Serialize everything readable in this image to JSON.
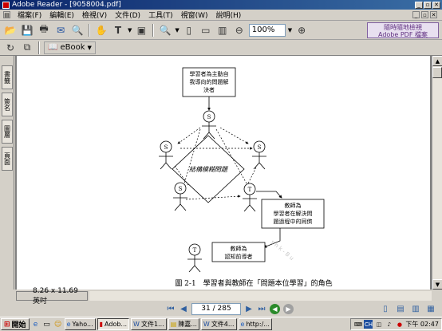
{
  "window": {
    "title": "Adobe Reader - [9058004.pdf]"
  },
  "menu": [
    "檔案(F)",
    "編輯(E)",
    "檢視(V)",
    "文件(D)",
    "工具(T)",
    "視窗(W)",
    "說明(H)"
  ],
  "toolbar": {
    "zoom_value": "100%",
    "ebook_label": "eBook"
  },
  "ad_box": {
    "line1": "隨時隨地檢視",
    "line2": "Adobe PDF 檔案"
  },
  "nav_tabs": [
    "書籤",
    "簽名",
    "圖層",
    "頁面"
  ],
  "diagram": {
    "top_box": [
      "學習者為主動自",
      "我導向的問題解",
      "決者"
    ],
    "center_label": "結構模糊問題",
    "teacher_box_right": [
      "教師為",
      "學習者在解決問",
      "題過程中的同儕"
    ],
    "teacher_box_bottom": [
      "教師為",
      "認知前導者"
    ],
    "student_letter": "S",
    "teacher_letter": "T",
    "caption": "圖 2-1　學習者與教師在「問題本位學習」的角色",
    "watermark": "s n k - B u"
  },
  "status": {
    "page_size": "8.26 x 11.69 英吋"
  },
  "page_nav": {
    "page_value": "31 / 285"
  },
  "taskbar": {
    "start_label": "開始",
    "tasks": [
      {
        "label": "Yaho...",
        "active": false
      },
      {
        "label": "Adob...",
        "active": true
      },
      {
        "label": "文件1...",
        "active": false
      },
      {
        "label": "陳嘉...",
        "active": false
      },
      {
        "label": "文件4...",
        "active": false
      },
      {
        "label": "http:/...",
        "active": false
      }
    ],
    "clock": "下午 02:47",
    "ime_label": "CH"
  },
  "colors": {
    "title_bar": "#0a246a",
    "nav_accent": "#3060a0",
    "green_circle": "#2a8a2a"
  }
}
